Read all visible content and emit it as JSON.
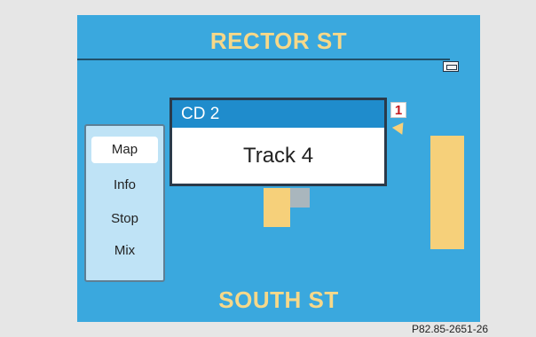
{
  "map": {
    "street_top": "RECTOR ST",
    "street_bottom": "SOUTH ST"
  },
  "menu": {
    "items": [
      {
        "label": "Map",
        "selected": true
      },
      {
        "label": "Info",
        "selected": false
      },
      {
        "label": "Stop",
        "selected": false
      },
      {
        "label": "Mix",
        "selected": false
      }
    ]
  },
  "cd_popup": {
    "disc": "CD 2",
    "track": "Track 4"
  },
  "callout_number": "1",
  "reference_code": "P82.85-2651-26",
  "colors": {
    "screen_bg": "#3aa8de",
    "street_text": "#f6d889",
    "header_bg": "#1f8ccc",
    "callout_text": "#c2181f"
  }
}
